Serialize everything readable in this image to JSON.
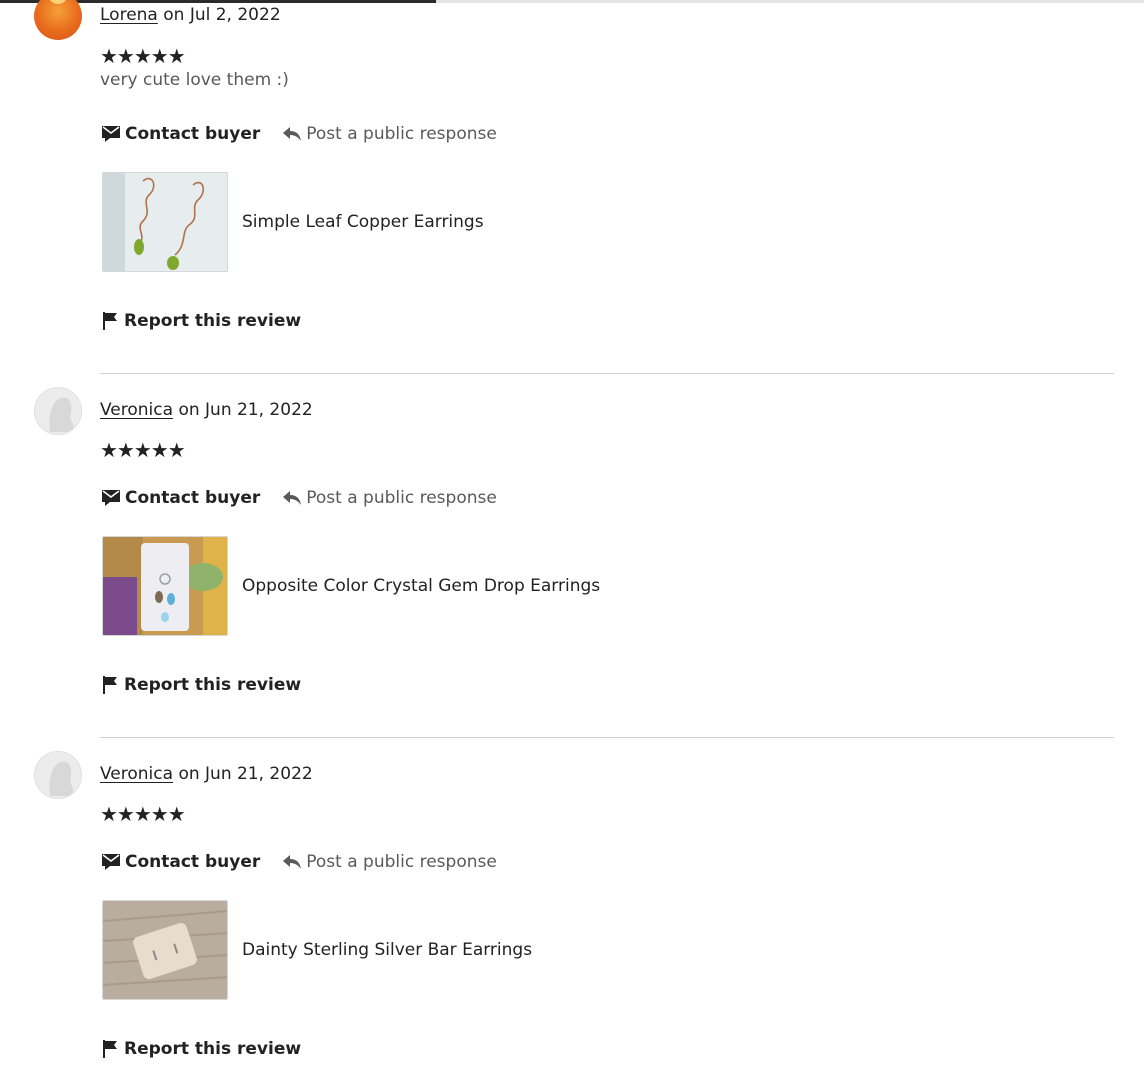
{
  "colors": {
    "text": "#222222",
    "muted": "#595959",
    "divider": "#d2d2d2"
  },
  "reviews": [
    {
      "reviewer": "Lorena",
      "date_text": " on Jul 2, 2022",
      "stars": "★★★★★",
      "rating": 5,
      "text": "very cute love them :)",
      "contact_label": "Contact buyer",
      "respond_label": "Post a public response",
      "product_title": "Simple Leaf Copper Earrings",
      "report_label": "Report this review",
      "avatar_icon": "user-avatar-photo"
    },
    {
      "reviewer": "Veronica",
      "date_text": " on Jun 21, 2022",
      "stars": "★★★★★",
      "rating": 5,
      "contact_label": "Contact buyer",
      "respond_label": "Post a public response",
      "product_title": "Opposite Color Crystal Gem Drop Earrings",
      "report_label": "Report this review",
      "avatar_icon": "default-avatar-icon"
    },
    {
      "reviewer": "Veronica",
      "date_text": " on Jun 21, 2022",
      "stars": "★★★★★",
      "rating": 5,
      "contact_label": "Contact buyer",
      "respond_label": "Post a public response",
      "product_title": "Dainty Sterling Silver Bar Earrings",
      "report_label": "Report this review",
      "avatar_icon": "default-avatar-icon"
    }
  ]
}
